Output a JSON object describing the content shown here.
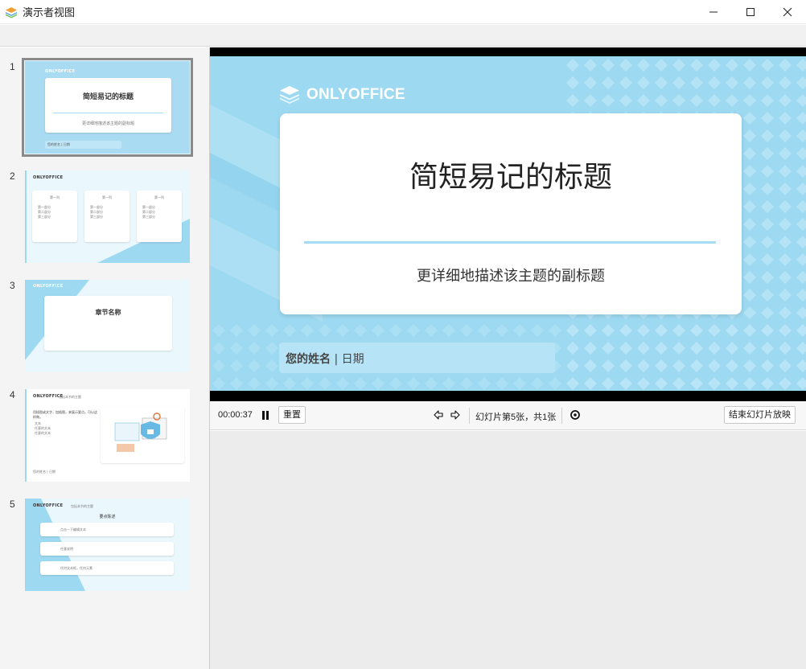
{
  "window": {
    "title": "演示者视图",
    "icons": {
      "app": "app-layers-icon",
      "minimize": "minimize-icon",
      "maximize": "maximize-icon",
      "close": "close-icon"
    }
  },
  "thumbnails": [
    {
      "number": "1",
      "title": "简短易记的标题",
      "subtitle": "更详细地描述该主题的副标题",
      "footer": "您的姓名 | 日期",
      "logo": "ONLYOFFICE"
    },
    {
      "number": "2",
      "logo": "ONLYOFFICE",
      "columns": [
        "第一列",
        "第一列",
        "第一列"
      ],
      "bullets": [
        "第一部分",
        "第二部分",
        "第三部分"
      ]
    },
    {
      "number": "3",
      "logo": "ONLYOFFICE",
      "title": "章节名称"
    },
    {
      "number": "4",
      "logo": "ONLYOFFICE",
      "heading": "包括本节的主题",
      "body": "用插图或文字，加插图，来展示要点。可以这样做。",
      "bullets": [
        "文本",
        "任意的文本",
        "任意的文本"
      ],
      "footer": "您的姓名 | 日期"
    },
    {
      "number": "5",
      "logo": "ONLYOFFICE",
      "heading": "包括本节的主题",
      "subheading": "要点陈述",
      "items": [
        "点击一下编辑文本",
        "任意说明",
        "任何文本框，任何元素"
      ]
    }
  ],
  "slide": {
    "logo": "ONLYOFFICE",
    "title": "简短易记的标题",
    "subtitle": "更详细地描述该主题的副标题",
    "name": "您的姓名",
    "separator": "|",
    "date": "日期"
  },
  "controls": {
    "timer": "00:00:37",
    "reset_label": "重置",
    "slide_counter": "幻灯片第5张，共1张",
    "end_label": "结束幻灯片放映",
    "icons": {
      "pause": "pause-icon",
      "prev": "arrow-left-icon",
      "next": "arrow-right-icon",
      "pointer": "laser-pointer-icon"
    }
  },
  "colors": {
    "slide_bg": "#9dd9f1",
    "accent_line": "#a6dcf3",
    "notes_bg": "#ececec"
  }
}
